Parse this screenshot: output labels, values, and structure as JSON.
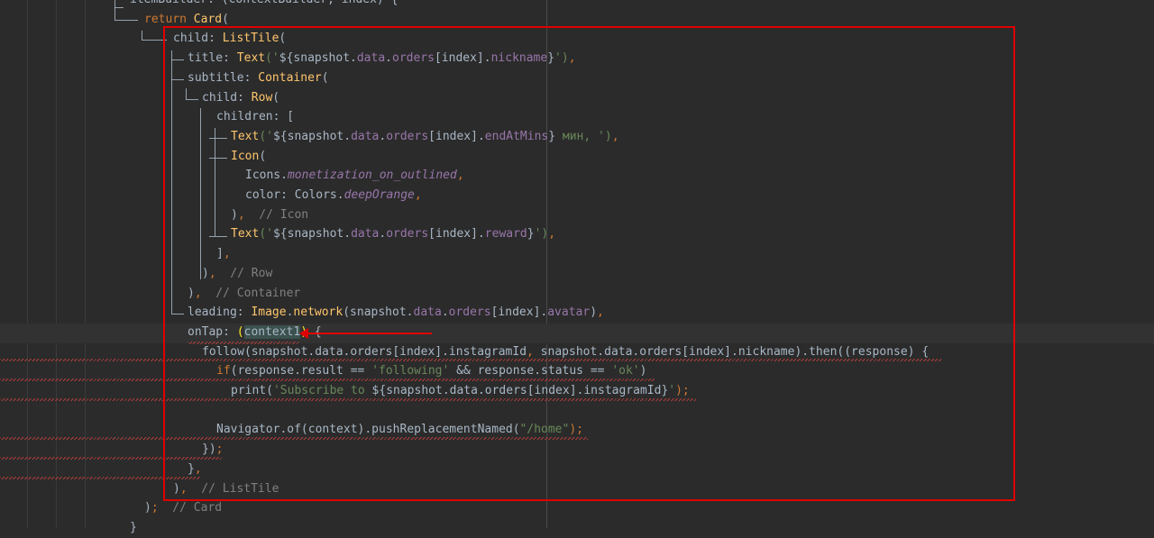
{
  "colors": {
    "background": "#2b2b2b",
    "keyword": "#cc7832",
    "class_name": "#ffc66d",
    "property": "#9876aa",
    "string": "#6a8759",
    "comment": "#808080",
    "text": "#a9b7c6",
    "annotation": "#e00000",
    "error_squiggle": "#bc3f3c"
  },
  "lines": [
    [
      {
        "t": "itemBuilder: (contextBuilder, index) {",
        "c": "plain"
      }
    ],
    [
      {
        "t": "return ",
        "c": "keyword"
      },
      {
        "t": "Card",
        "c": "class"
      },
      {
        "t": "(",
        "c": "paren"
      }
    ],
    [
      {
        "t": "child: ",
        "c": "plain"
      },
      {
        "t": "ListTile",
        "c": "class"
      },
      {
        "t": "(",
        "c": "paren"
      }
    ],
    [
      {
        "t": "title: ",
        "c": "plain"
      },
      {
        "t": "Text",
        "c": "class"
      },
      {
        "t": "('",
        "c": "string"
      },
      {
        "t": "${snapshot.",
        "c": "plain"
      },
      {
        "t": "data",
        "c": "property"
      },
      {
        "t": ".",
        "c": "plain"
      },
      {
        "t": "orders",
        "c": "property"
      },
      {
        "t": "[index].",
        "c": "plain"
      },
      {
        "t": "nickname",
        "c": "property"
      },
      {
        "t": "}",
        "c": "plain"
      },
      {
        "t": "')",
        "c": "string"
      },
      {
        "t": ",",
        "c": "punct"
      }
    ],
    [
      {
        "t": "subtitle: ",
        "c": "plain"
      },
      {
        "t": "Container",
        "c": "class"
      },
      {
        "t": "(",
        "c": "paren"
      }
    ],
    [
      {
        "t": "child: ",
        "c": "plain"
      },
      {
        "t": "Row",
        "c": "class"
      },
      {
        "t": "(",
        "c": "paren"
      }
    ],
    [
      {
        "t": "children: [",
        "c": "plain"
      }
    ],
    [
      {
        "t": "Text",
        "c": "class"
      },
      {
        "t": "('",
        "c": "string"
      },
      {
        "t": "${snapshot.",
        "c": "plain"
      },
      {
        "t": "data",
        "c": "property"
      },
      {
        "t": ".",
        "c": "plain"
      },
      {
        "t": "orders",
        "c": "property"
      },
      {
        "t": "[index].",
        "c": "plain"
      },
      {
        "t": "endAtMins",
        "c": "property"
      },
      {
        "t": "}",
        "c": "plain"
      },
      {
        "t": " мин, ')",
        "c": "string"
      },
      {
        "t": ",",
        "c": "punct"
      }
    ],
    [
      {
        "t": "Icon",
        "c": "class"
      },
      {
        "t": "(",
        "c": "paren"
      }
    ],
    [
      {
        "t": "Icons.",
        "c": "plain"
      },
      {
        "t": "monetization_on_outlined",
        "c": "italic"
      },
      {
        "t": ",",
        "c": "punct"
      }
    ],
    [
      {
        "t": "color: Colors.",
        "c": "plain"
      },
      {
        "t": "deepOrange",
        "c": "italic"
      },
      {
        "t": ",",
        "c": "punct"
      }
    ],
    [
      {
        "t": ")",
        "c": "paren"
      },
      {
        "t": ",",
        "c": "punct"
      },
      {
        "t": "  // Icon",
        "c": "comment"
      }
    ],
    [
      {
        "t": "Text",
        "c": "class"
      },
      {
        "t": "('",
        "c": "string"
      },
      {
        "t": "${snapshot.",
        "c": "plain"
      },
      {
        "t": "data",
        "c": "property"
      },
      {
        "t": ".",
        "c": "plain"
      },
      {
        "t": "orders",
        "c": "property"
      },
      {
        "t": "[index].",
        "c": "plain"
      },
      {
        "t": "reward",
        "c": "property"
      },
      {
        "t": "}",
        "c": "plain"
      },
      {
        "t": "')",
        "c": "string"
      },
      {
        "t": ",",
        "c": "punct"
      }
    ],
    [
      {
        "t": "]",
        "c": "paren"
      },
      {
        "t": ",",
        "c": "punct"
      }
    ],
    [
      {
        "t": ")",
        "c": "paren"
      },
      {
        "t": ",",
        "c": "punct"
      },
      {
        "t": "  // Row",
        "c": "comment"
      }
    ],
    [
      {
        "t": ")",
        "c": "paren"
      },
      {
        "t": ",",
        "c": "punct"
      },
      {
        "t": "  // Container",
        "c": "comment"
      }
    ],
    [
      {
        "t": "leading: ",
        "c": "plain"
      },
      {
        "t": "Image",
        "c": "class"
      },
      {
        "t": ".",
        "c": "plain"
      },
      {
        "t": "network",
        "c": "class"
      },
      {
        "t": "(snapshot.",
        "c": "plain"
      },
      {
        "t": "data",
        "c": "property"
      },
      {
        "t": ".",
        "c": "plain"
      },
      {
        "t": "orders",
        "c": "property"
      },
      {
        "t": "[index].",
        "c": "plain"
      },
      {
        "t": "avatar",
        "c": "property"
      },
      {
        "t": ")",
        "c": "paren"
      },
      {
        "t": ",",
        "c": "punct"
      }
    ],
    [
      {
        "t": "onTap: ",
        "c": "plain"
      },
      {
        "t": "(",
        "c": "yellow"
      },
      {
        "t": "context1",
        "c": "hl"
      },
      {
        "t": ")",
        "c": "yellow"
      },
      {
        "t": " {",
        "c": "brace"
      }
    ],
    [
      {
        "t": "follow(snapshot.data.orders[index].instagramId",
        "c": "plain"
      },
      {
        "t": ",",
        "c": "punct"
      },
      {
        "t": " snapshot.data.orders[index].nickname).then((response) {",
        "c": "plain"
      }
    ],
    [
      {
        "t": "if",
        "c": "keyword"
      },
      {
        "t": "(response.result == ",
        "c": "plain"
      },
      {
        "t": "'following'",
        "c": "string"
      },
      {
        "t": " && response.status == ",
        "c": "plain"
      },
      {
        "t": "'ok'",
        "c": "string"
      },
      {
        "t": ")",
        "c": "plain"
      }
    ],
    [
      {
        "t": "print(",
        "c": "plain"
      },
      {
        "t": "'Subscribe to ",
        "c": "string"
      },
      {
        "t": "${snapshot.data.orders[index].instagramId}",
        "c": "plain"
      },
      {
        "t": "'",
        "c": "string"
      },
      {
        "t": ");",
        "c": "punct"
      }
    ],
    [
      {
        "t": "",
        "c": "plain"
      }
    ],
    [
      {
        "t": "Navigator.of(context).pushReplacementNamed(",
        "c": "plain"
      },
      {
        "t": "\"/home\"",
        "c": "string"
      },
      {
        "t": ");",
        "c": "punct"
      }
    ],
    [
      {
        "t": "})",
        "c": "plain"
      },
      {
        "t": ";",
        "c": "punct"
      }
    ],
    [
      {
        "t": "}",
        "c": "plain"
      },
      {
        "t": ",",
        "c": "punct"
      }
    ],
    [
      {
        "t": ")",
        "c": "paren"
      },
      {
        "t": ",",
        "c": "punct"
      },
      {
        "t": "  // ListTile",
        "c": "comment"
      }
    ],
    [
      {
        "t": ")",
        "c": "paren"
      },
      {
        "t": ";",
        "c": "punct"
      },
      {
        "t": "  // Card",
        "c": "comment"
      }
    ],
    [
      {
        "t": "}",
        "c": "plain"
      }
    ]
  ]
}
